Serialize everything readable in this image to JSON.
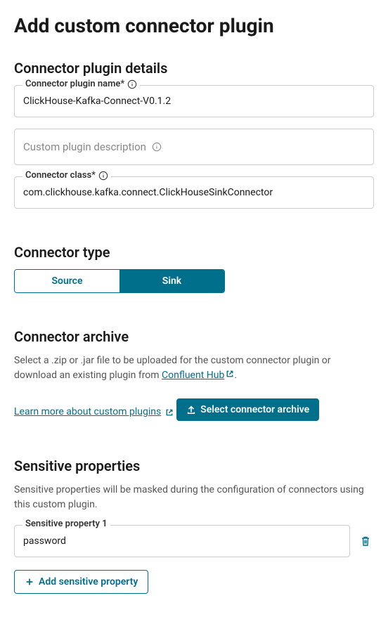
{
  "page_title": "Add custom connector plugin",
  "details": {
    "heading": "Connector plugin details",
    "name_label": "Connector plugin name*",
    "name_value": "ClickHouse-Kafka-Connect-V0.1.2",
    "desc_placeholder": "Custom plugin description",
    "class_label": "Connector class*",
    "class_value": "com.clickhouse.kafka.connect.ClickHouseSinkConnector"
  },
  "type": {
    "heading": "Connector type",
    "source_label": "Source",
    "sink_label": "Sink"
  },
  "archive": {
    "heading": "Connector archive",
    "desc_part1": "Select a .zip or .jar file to be uploaded for the custom connector plugin or download an existing plugin from ",
    "hub_link": "Confluent Hub",
    "desc_part2": ".",
    "learn_more": "Learn more about custom plugins",
    "select_button": "Select connector archive"
  },
  "sensitive": {
    "heading": "Sensitive properties",
    "desc": "Sensitive properties will be masked during the configuration of connectors using this custom plugin.",
    "prop1_label": "Sensitive property 1",
    "prop1_value": "password",
    "add_button": "Add sensitive property"
  }
}
